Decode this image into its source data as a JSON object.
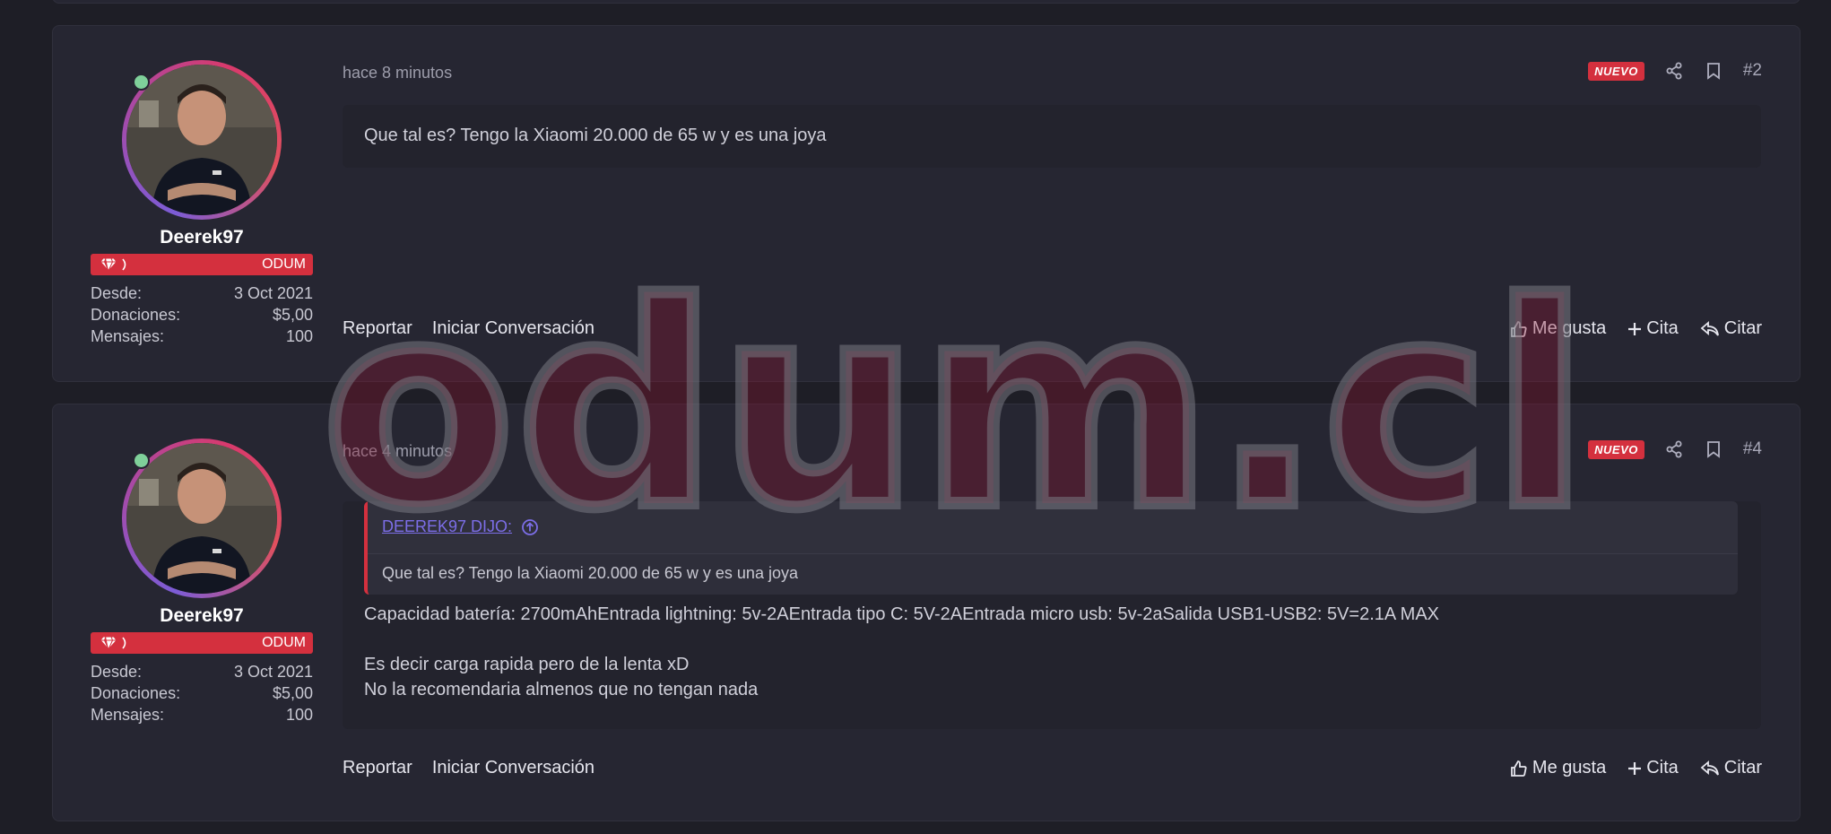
{
  "posts": [
    {
      "time": "hace 8 minutos",
      "badge": "NUEVO",
      "number": "#2",
      "user": {
        "name": "Deerek97",
        "rank": "ODUM",
        "stats": [
          {
            "label": "Desde:",
            "value": "3 Oct 2021"
          },
          {
            "label": "Donaciones:",
            "value": "$5,00"
          },
          {
            "label": "Mensajes:",
            "value": "100"
          }
        ]
      },
      "body": [
        "Que tal es? Tengo la Xiaomi 20.000 de 65 w y es una joya"
      ],
      "actions": {
        "report": "Reportar",
        "conversation": "Iniciar Conversación",
        "like": "Me gusta",
        "add_quote": "Cita",
        "quote": "Citar"
      }
    },
    {
      "time": "hace 4 minutos",
      "badge": "NUEVO",
      "number": "#4",
      "user": {
        "name": "Deerek97",
        "rank": "ODUM",
        "stats": [
          {
            "label": "Desde:",
            "value": "3 Oct 2021"
          },
          {
            "label": "Donaciones:",
            "value": "$5,00"
          },
          {
            "label": "Mensajes:",
            "value": "100"
          }
        ]
      },
      "quote": {
        "author": "DEEREK97 DIJO:",
        "text": "Que tal es? Tengo la Xiaomi 20.000 de 65 w y es una joya"
      },
      "body": [
        "Capacidad batería: 2700mAhEntrada lightning: 5v-2AEntrada tipo C: 5V-2AEntrada micro usb: 5v-2aSalida USB1-USB2: 5V=2.1A MAX",
        "",
        "Es decir carga rapida pero de la lenta xD",
        "No la recomendaria almenos que no tengan nada"
      ],
      "actions": {
        "report": "Reportar",
        "conversation": "Iniciar Conversación",
        "like": "Me gusta",
        "add_quote": "Cita",
        "quote": "Citar"
      }
    }
  ],
  "watermark": "odum.cl",
  "colors": {
    "accent": "#d4303e",
    "link": "#7c6ee8",
    "online": "#7fd09a",
    "background": "#1e1e26",
    "card": "#262632"
  },
  "icons": [
    "share-icon",
    "bookmark-icon",
    "thumbs-up-icon",
    "plus-icon",
    "reply-icon",
    "diamond-icon",
    "arrow-up-circle-icon"
  ]
}
